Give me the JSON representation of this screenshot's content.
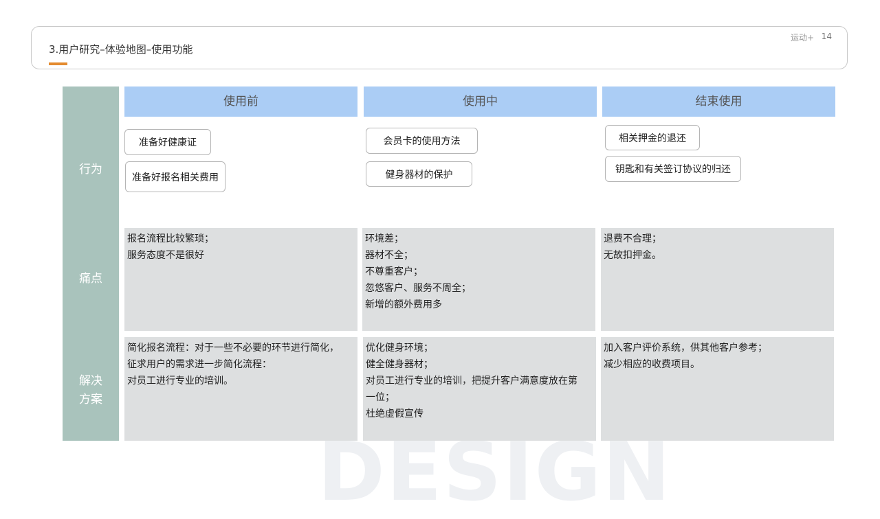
{
  "header": {
    "title": "3.用户研究–体验地图–使用功能",
    "brand": "运动+",
    "page_number": "14",
    "accent_color": "#e48b2f"
  },
  "watermark": "DESIGN",
  "rows": {
    "behavior": "行为",
    "pain_points": "痛点",
    "solution_line1": "解决",
    "solution_line2": "方案"
  },
  "columns": [
    "使用前",
    "使用中",
    "结束使用"
  ],
  "behaviors": {
    "before": [
      "准备好健康证",
      "准备好报名相关费用"
    ],
    "during": [
      "会员卡的使用方法",
      "健身器材的保护"
    ],
    "after": [
      "相关押金的退还",
      "钥匙和有关签订协议的归还"
    ]
  },
  "pain_points": {
    "before": [
      "报名流程比较繁琐；",
      "服务态度不是很好"
    ],
    "during": [
      "环境差；",
      "器材不全；",
      "不尊重客户；",
      "忽悠客户、服务不周全；",
      "新增的额外费用多"
    ],
    "after": [
      "退费不合理；",
      "无故扣押金。"
    ]
  },
  "solutions": {
    "before": [
      "简化报名流程：对于一些不必要的环节进行简化，",
      "征求用户的需求进一步简化流程：",
      "对员工进行专业的培训。"
    ],
    "during": [
      "优化健身环境；",
      "健全健身器材；",
      "对员工进行专业的培训，把提升客户满意度放在第",
      "一位；",
      "杜绝虚假宣传"
    ],
    "after": [
      "加入客户评价系统，供其他客户参考；",
      "减少相应的收费项目。"
    ]
  },
  "colors": {
    "row_label_bg": "#a9c3bc",
    "column_header_bg": "#abcdf5",
    "cell_bg": "#dddfe0"
  }
}
